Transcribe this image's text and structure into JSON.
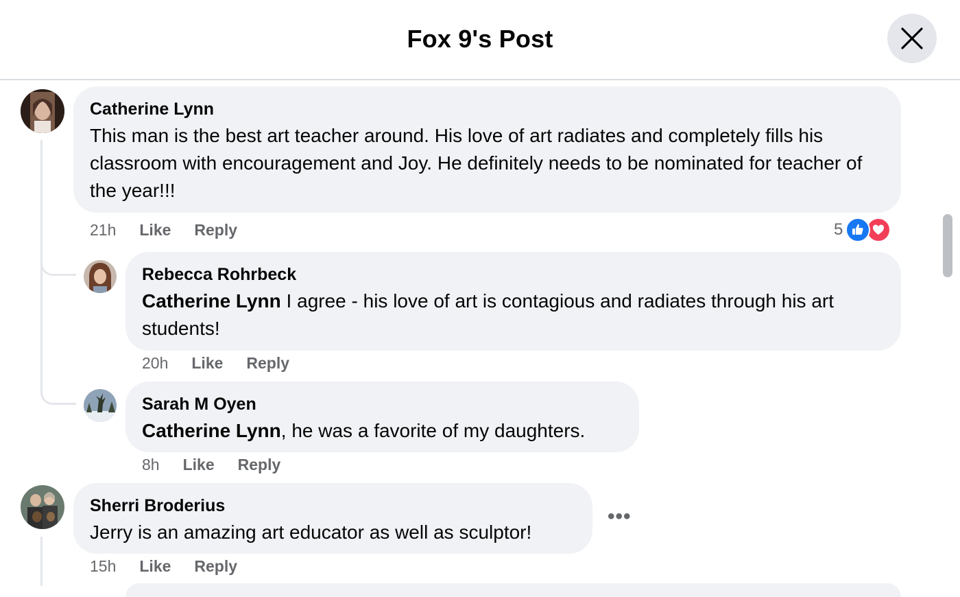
{
  "header": {
    "title": "Fox 9's Post",
    "close_icon": "close-icon"
  },
  "colors": {
    "bubble": "#f0f2f5",
    "meta_text": "#65676b",
    "like_blue": "#1877f2",
    "love_red": "#f33e58"
  },
  "comments": [
    {
      "author": "Catherine Lynn",
      "text": "This man is the best art teacher around. His love of art radiates and completely fills his classroom with encouragement and Joy. He definitely needs to be nominated for teacher of the year!!!",
      "time": "21h",
      "like_label": "Like",
      "reply_label": "Reply",
      "reaction_count": "5",
      "reaction_icons": [
        "like-icon",
        "love-icon"
      ]
    },
    {
      "author": "Rebecca Rohrbeck",
      "mention": "Catherine Lynn",
      "text": " I agree - his love of art is contagious and radiates through his art students!",
      "time": "20h",
      "like_label": "Like",
      "reply_label": "Reply"
    },
    {
      "author": "Sarah M Oyen",
      "mention": "Catherine Lynn",
      "text": ", he was a favorite of my daughters.",
      "time": "8h",
      "like_label": "Like",
      "reply_label": "Reply"
    },
    {
      "author": "Sherri Broderius",
      "text": "Jerry is an amazing art educator as well as sculptor!",
      "time": "15h",
      "like_label": "Like",
      "reply_label": "Reply",
      "more_icon": "more-options-icon",
      "more_label": "•••"
    }
  ]
}
